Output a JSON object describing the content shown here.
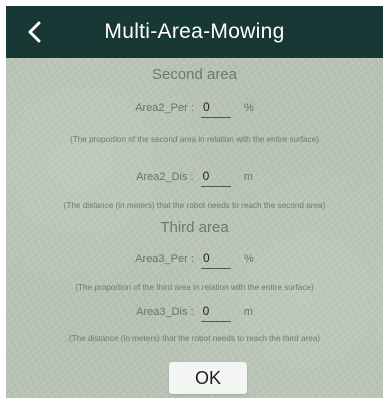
{
  "header": {
    "title": "Multi-Area-Mowing",
    "back_icon": "chevron-left-icon"
  },
  "second_area": {
    "title": "Second area",
    "per_label": "Area2_Per :",
    "per_value": "0",
    "per_unit": "%",
    "per_note": "(The proportion of the second area in relation with the entire surface)",
    "dis_label": "Area2_Dis :",
    "dis_value": "0",
    "dis_unit": "m",
    "dis_note": "(The distance (in meters) that the robot needs to reach the second area)"
  },
  "third_area": {
    "title": "Third area",
    "per_label": "Area3_Per :",
    "per_value": "0",
    "per_unit": "%",
    "per_note": "(The proportion of the third area in relation with the entire surface)",
    "dis_label": "Area3_Dis :",
    "dis_value": "0",
    "dis_unit": "m",
    "dis_note": "(The distance (in meters) that the robot needs to reach the third area)"
  },
  "actions": {
    "ok_label": "OK"
  },
  "colors": {
    "header_bg": "#173834",
    "content_bg": "#b7c2b4",
    "button_bg": "#f3f5f2"
  }
}
